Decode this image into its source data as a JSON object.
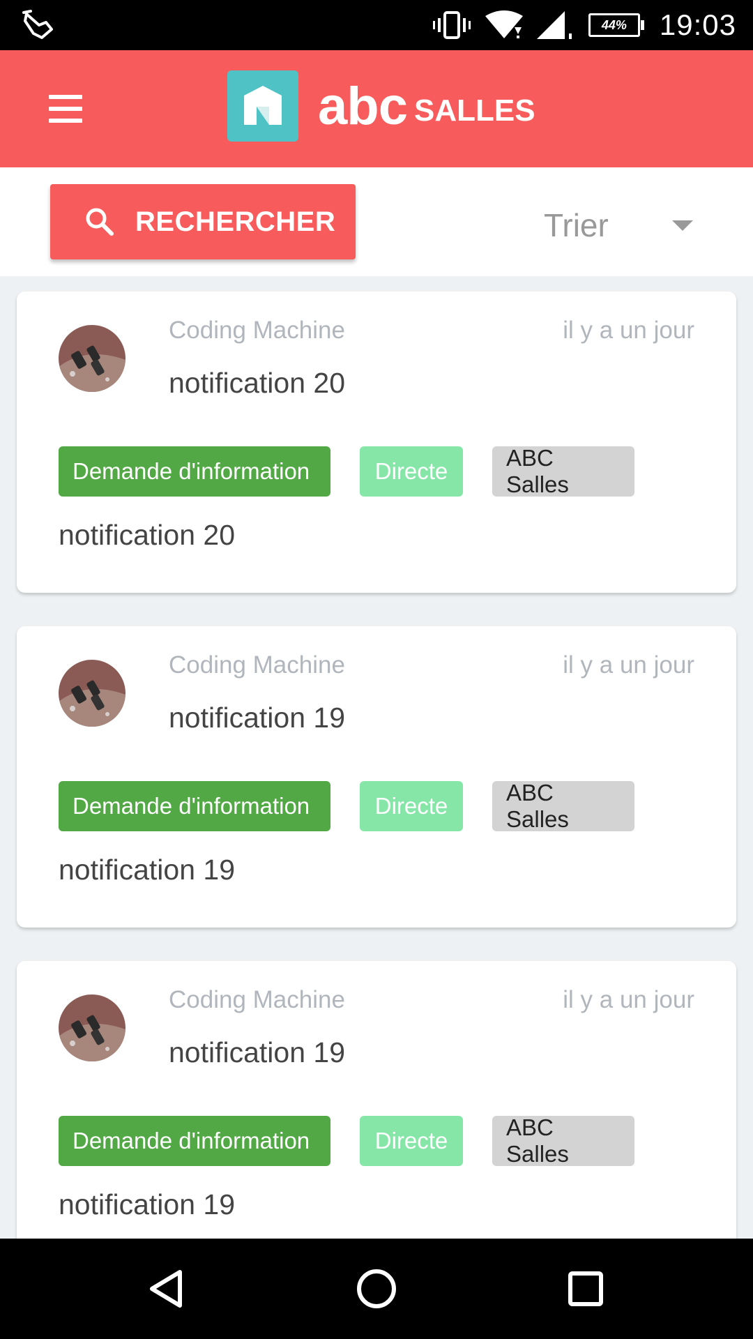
{
  "status_bar": {
    "time": "19:03",
    "battery": "44%",
    "icons": [
      "tap-hand-icon",
      "vibrate-icon",
      "wifi-icon",
      "signal-icon",
      "battery-icon"
    ]
  },
  "app_bar": {
    "brand_name": "abc",
    "brand_suffix": "SALLES",
    "colors": {
      "primary": "#f75b5b",
      "logo": "#4ec2c4"
    }
  },
  "toolbar": {
    "search_label": "RECHERCHER",
    "sort_label": "Trier"
  },
  "notifications": [
    {
      "sender": "Coding Machine",
      "time": "il y a un jour",
      "subject": "notification 20",
      "tags": [
        "Demande d'information",
        "Directe",
        "ABC Salles"
      ],
      "body": "notification 20"
    },
    {
      "sender": "Coding Machine",
      "time": "il y a un jour",
      "subject": "notification 19",
      "tags": [
        "Demande d'information",
        "Directe",
        "ABC Salles"
      ],
      "body": "notification 19"
    },
    {
      "sender": "Coding Machine",
      "time": "il y a un jour",
      "subject": "notification 19",
      "tags": [
        "Demande d'information",
        "Directe",
        "ABC Salles"
      ],
      "body": "notification 19"
    }
  ],
  "tag_colors": {
    "type": "#52a845",
    "mode": "#86e6a8",
    "org": "#d3d3d3"
  },
  "nav_bar": {
    "icons": [
      "back-icon",
      "home-icon",
      "recents-icon"
    ]
  }
}
